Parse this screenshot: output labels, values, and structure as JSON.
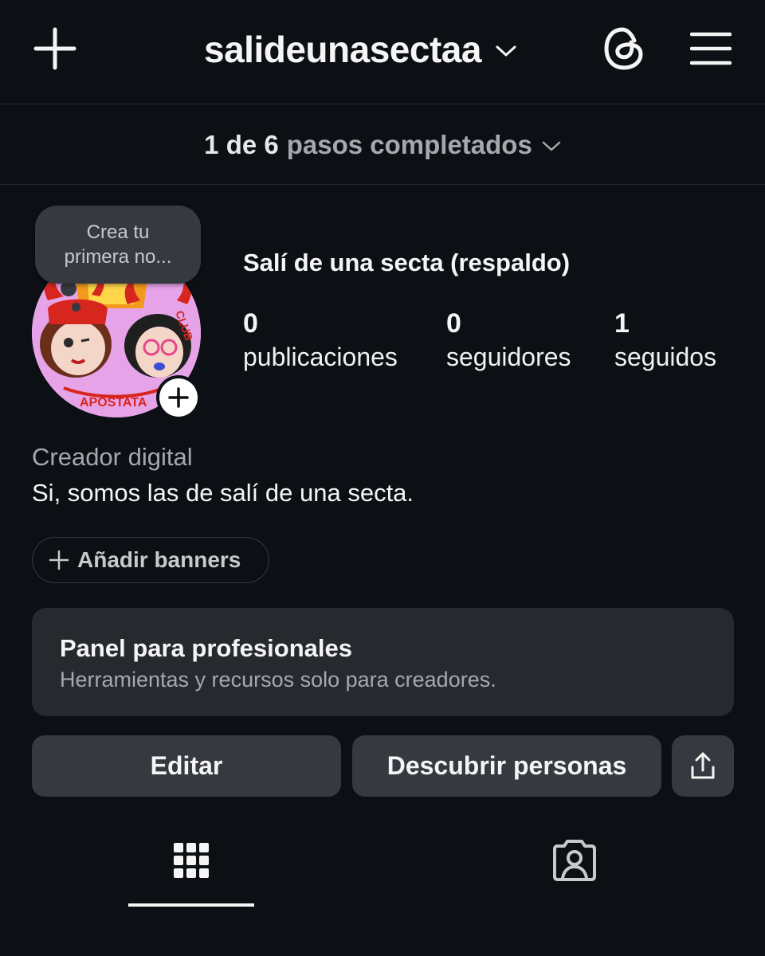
{
  "header": {
    "username": "salideunasectaa",
    "icons": [
      "plus-icon",
      "chevron-down-icon",
      "threads-icon",
      "hamburger-menu-icon"
    ]
  },
  "steps": {
    "count": "1 de 6",
    "label": "pasos completados"
  },
  "profile": {
    "note": [
      "Crea tu",
      "primera no..."
    ],
    "display_name": "Salí de una secta (respaldo)",
    "stats": [
      {
        "value": "0",
        "label": "publicaciones"
      },
      {
        "value": "0",
        "label": "seguidores"
      },
      {
        "value": "1",
        "label": "seguidos"
      }
    ],
    "category": "Creador digital",
    "bio": "Si, somos las de salí de una secta.",
    "avatar_caption": "APÓSTATA",
    "avatar_club": "CLUB"
  },
  "banners": {
    "label": "Añadir banners"
  },
  "pro_panel": {
    "title": "Panel para profesionales",
    "subtitle": "Herramientas y recursos solo para creadores."
  },
  "actions": {
    "edit": "Editar",
    "discover": "Descubrir personas"
  },
  "tabs": [
    {
      "name": "grid",
      "icon": "grid-icon",
      "active": true
    },
    {
      "name": "tagged",
      "icon": "tagged-person-icon",
      "active": false
    }
  ],
  "colors": {
    "background": "#0c1014",
    "surface": "#262a2f",
    "button": "#363a40",
    "text": "#f5f5f5",
    "muted": "#a5a9ae",
    "avatar_bg": "#e6a3e8"
  }
}
